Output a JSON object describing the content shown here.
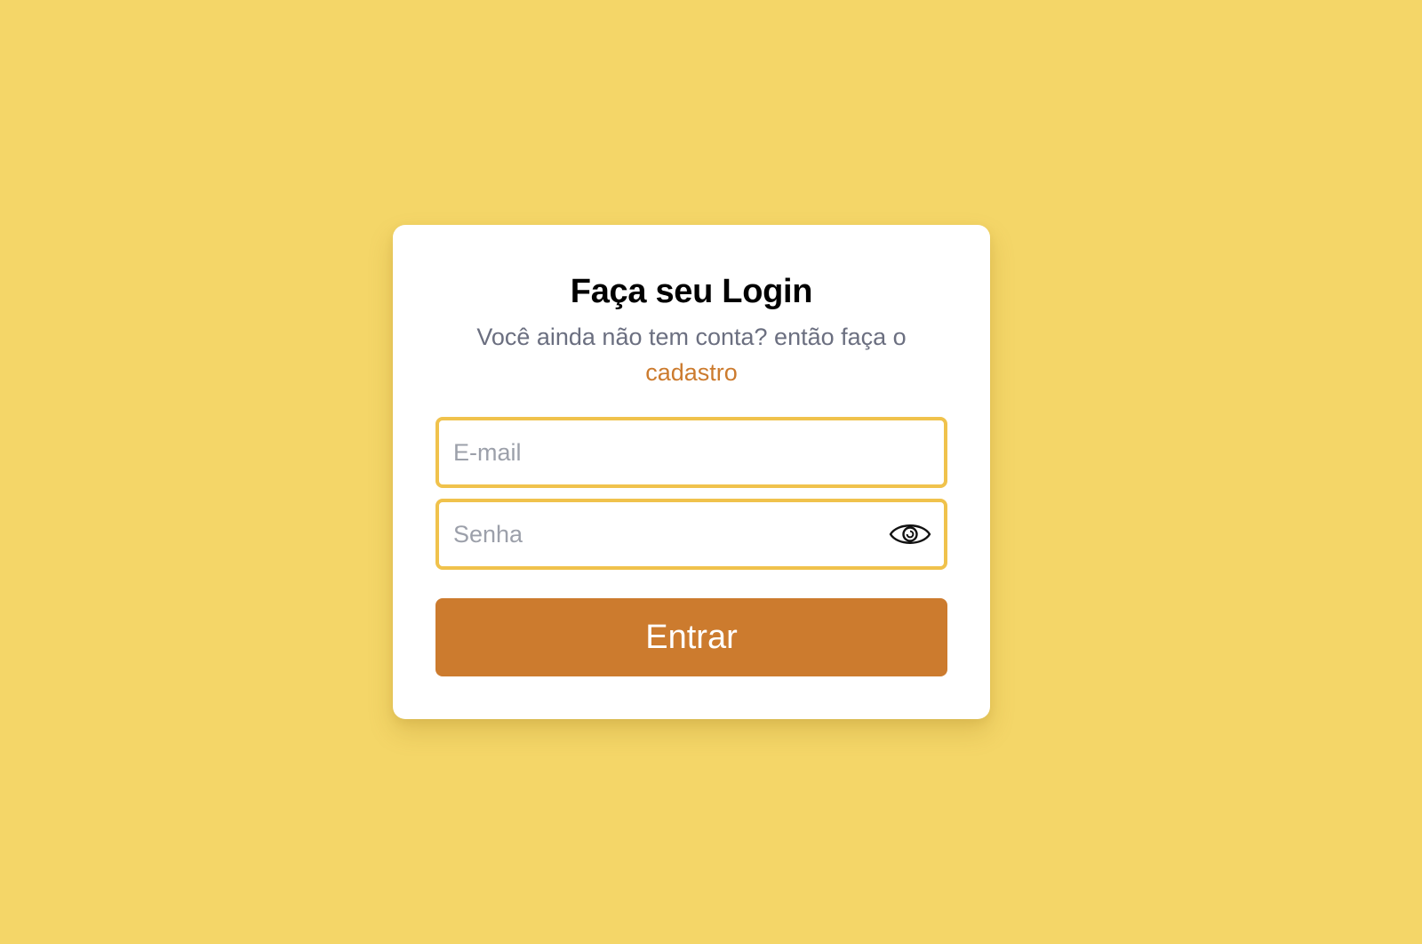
{
  "login": {
    "title": "Faça seu Login",
    "subtitle_text": "Você ainda não tem conta? então faça o",
    "signup_link": "cadastro",
    "email": {
      "placeholder": "E-mail",
      "value": ""
    },
    "password": {
      "placeholder": "Senha",
      "value": "",
      "toggle_icon": "eye-icon"
    },
    "submit_label": "Entrar"
  },
  "colors": {
    "background": "#F4D668",
    "card": "#FFFFFF",
    "accent": "#CC7B2E",
    "input_border": "#F0C24C",
    "subtitle": "#6B6F80",
    "placeholder": "#9CA0AA"
  }
}
